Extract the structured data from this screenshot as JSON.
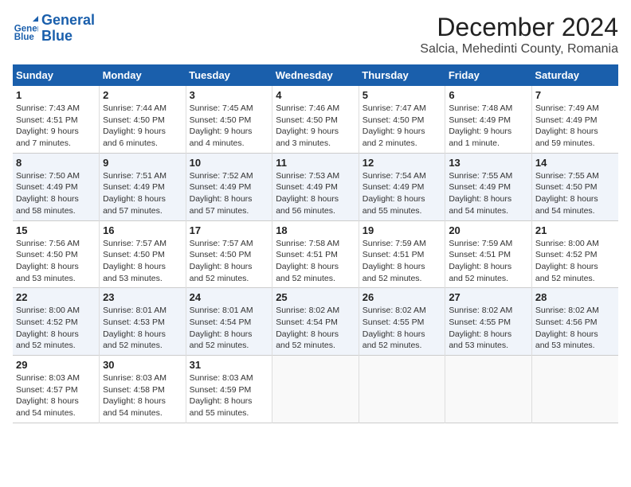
{
  "logo": {
    "line1": "General",
    "line2": "Blue"
  },
  "title": "December 2024",
  "subtitle": "Salcia, Mehedinti County, Romania",
  "days_of_week": [
    "Sunday",
    "Monday",
    "Tuesday",
    "Wednesday",
    "Thursday",
    "Friday",
    "Saturday"
  ],
  "weeks": [
    [
      {
        "day": "1",
        "info": "Sunrise: 7:43 AM\nSunset: 4:51 PM\nDaylight: 9 hours\nand 7 minutes."
      },
      {
        "day": "2",
        "info": "Sunrise: 7:44 AM\nSunset: 4:50 PM\nDaylight: 9 hours\nand 6 minutes."
      },
      {
        "day": "3",
        "info": "Sunrise: 7:45 AM\nSunset: 4:50 PM\nDaylight: 9 hours\nand 4 minutes."
      },
      {
        "day": "4",
        "info": "Sunrise: 7:46 AM\nSunset: 4:50 PM\nDaylight: 9 hours\nand 3 minutes."
      },
      {
        "day": "5",
        "info": "Sunrise: 7:47 AM\nSunset: 4:50 PM\nDaylight: 9 hours\nand 2 minutes."
      },
      {
        "day": "6",
        "info": "Sunrise: 7:48 AM\nSunset: 4:49 PM\nDaylight: 9 hours\nand 1 minute."
      },
      {
        "day": "7",
        "info": "Sunrise: 7:49 AM\nSunset: 4:49 PM\nDaylight: 8 hours\nand 59 minutes."
      }
    ],
    [
      {
        "day": "8",
        "info": "Sunrise: 7:50 AM\nSunset: 4:49 PM\nDaylight: 8 hours\nand 58 minutes."
      },
      {
        "day": "9",
        "info": "Sunrise: 7:51 AM\nSunset: 4:49 PM\nDaylight: 8 hours\nand 57 minutes."
      },
      {
        "day": "10",
        "info": "Sunrise: 7:52 AM\nSunset: 4:49 PM\nDaylight: 8 hours\nand 57 minutes."
      },
      {
        "day": "11",
        "info": "Sunrise: 7:53 AM\nSunset: 4:49 PM\nDaylight: 8 hours\nand 56 minutes."
      },
      {
        "day": "12",
        "info": "Sunrise: 7:54 AM\nSunset: 4:49 PM\nDaylight: 8 hours\nand 55 minutes."
      },
      {
        "day": "13",
        "info": "Sunrise: 7:55 AM\nSunset: 4:49 PM\nDaylight: 8 hours\nand 54 minutes."
      },
      {
        "day": "14",
        "info": "Sunrise: 7:55 AM\nSunset: 4:50 PM\nDaylight: 8 hours\nand 54 minutes."
      }
    ],
    [
      {
        "day": "15",
        "info": "Sunrise: 7:56 AM\nSunset: 4:50 PM\nDaylight: 8 hours\nand 53 minutes."
      },
      {
        "day": "16",
        "info": "Sunrise: 7:57 AM\nSunset: 4:50 PM\nDaylight: 8 hours\nand 53 minutes."
      },
      {
        "day": "17",
        "info": "Sunrise: 7:57 AM\nSunset: 4:50 PM\nDaylight: 8 hours\nand 52 minutes."
      },
      {
        "day": "18",
        "info": "Sunrise: 7:58 AM\nSunset: 4:51 PM\nDaylight: 8 hours\nand 52 minutes."
      },
      {
        "day": "19",
        "info": "Sunrise: 7:59 AM\nSunset: 4:51 PM\nDaylight: 8 hours\nand 52 minutes."
      },
      {
        "day": "20",
        "info": "Sunrise: 7:59 AM\nSunset: 4:51 PM\nDaylight: 8 hours\nand 52 minutes."
      },
      {
        "day": "21",
        "info": "Sunrise: 8:00 AM\nSunset: 4:52 PM\nDaylight: 8 hours\nand 52 minutes."
      }
    ],
    [
      {
        "day": "22",
        "info": "Sunrise: 8:00 AM\nSunset: 4:52 PM\nDaylight: 8 hours\nand 52 minutes."
      },
      {
        "day": "23",
        "info": "Sunrise: 8:01 AM\nSunset: 4:53 PM\nDaylight: 8 hours\nand 52 minutes."
      },
      {
        "day": "24",
        "info": "Sunrise: 8:01 AM\nSunset: 4:54 PM\nDaylight: 8 hours\nand 52 minutes."
      },
      {
        "day": "25",
        "info": "Sunrise: 8:02 AM\nSunset: 4:54 PM\nDaylight: 8 hours\nand 52 minutes."
      },
      {
        "day": "26",
        "info": "Sunrise: 8:02 AM\nSunset: 4:55 PM\nDaylight: 8 hours\nand 52 minutes."
      },
      {
        "day": "27",
        "info": "Sunrise: 8:02 AM\nSunset: 4:55 PM\nDaylight: 8 hours\nand 53 minutes."
      },
      {
        "day": "28",
        "info": "Sunrise: 8:02 AM\nSunset: 4:56 PM\nDaylight: 8 hours\nand 53 minutes."
      }
    ],
    [
      {
        "day": "29",
        "info": "Sunrise: 8:03 AM\nSunset: 4:57 PM\nDaylight: 8 hours\nand 54 minutes."
      },
      {
        "day": "30",
        "info": "Sunrise: 8:03 AM\nSunset: 4:58 PM\nDaylight: 8 hours\nand 54 minutes."
      },
      {
        "day": "31",
        "info": "Sunrise: 8:03 AM\nSunset: 4:59 PM\nDaylight: 8 hours\nand 55 minutes."
      },
      null,
      null,
      null,
      null
    ]
  ]
}
